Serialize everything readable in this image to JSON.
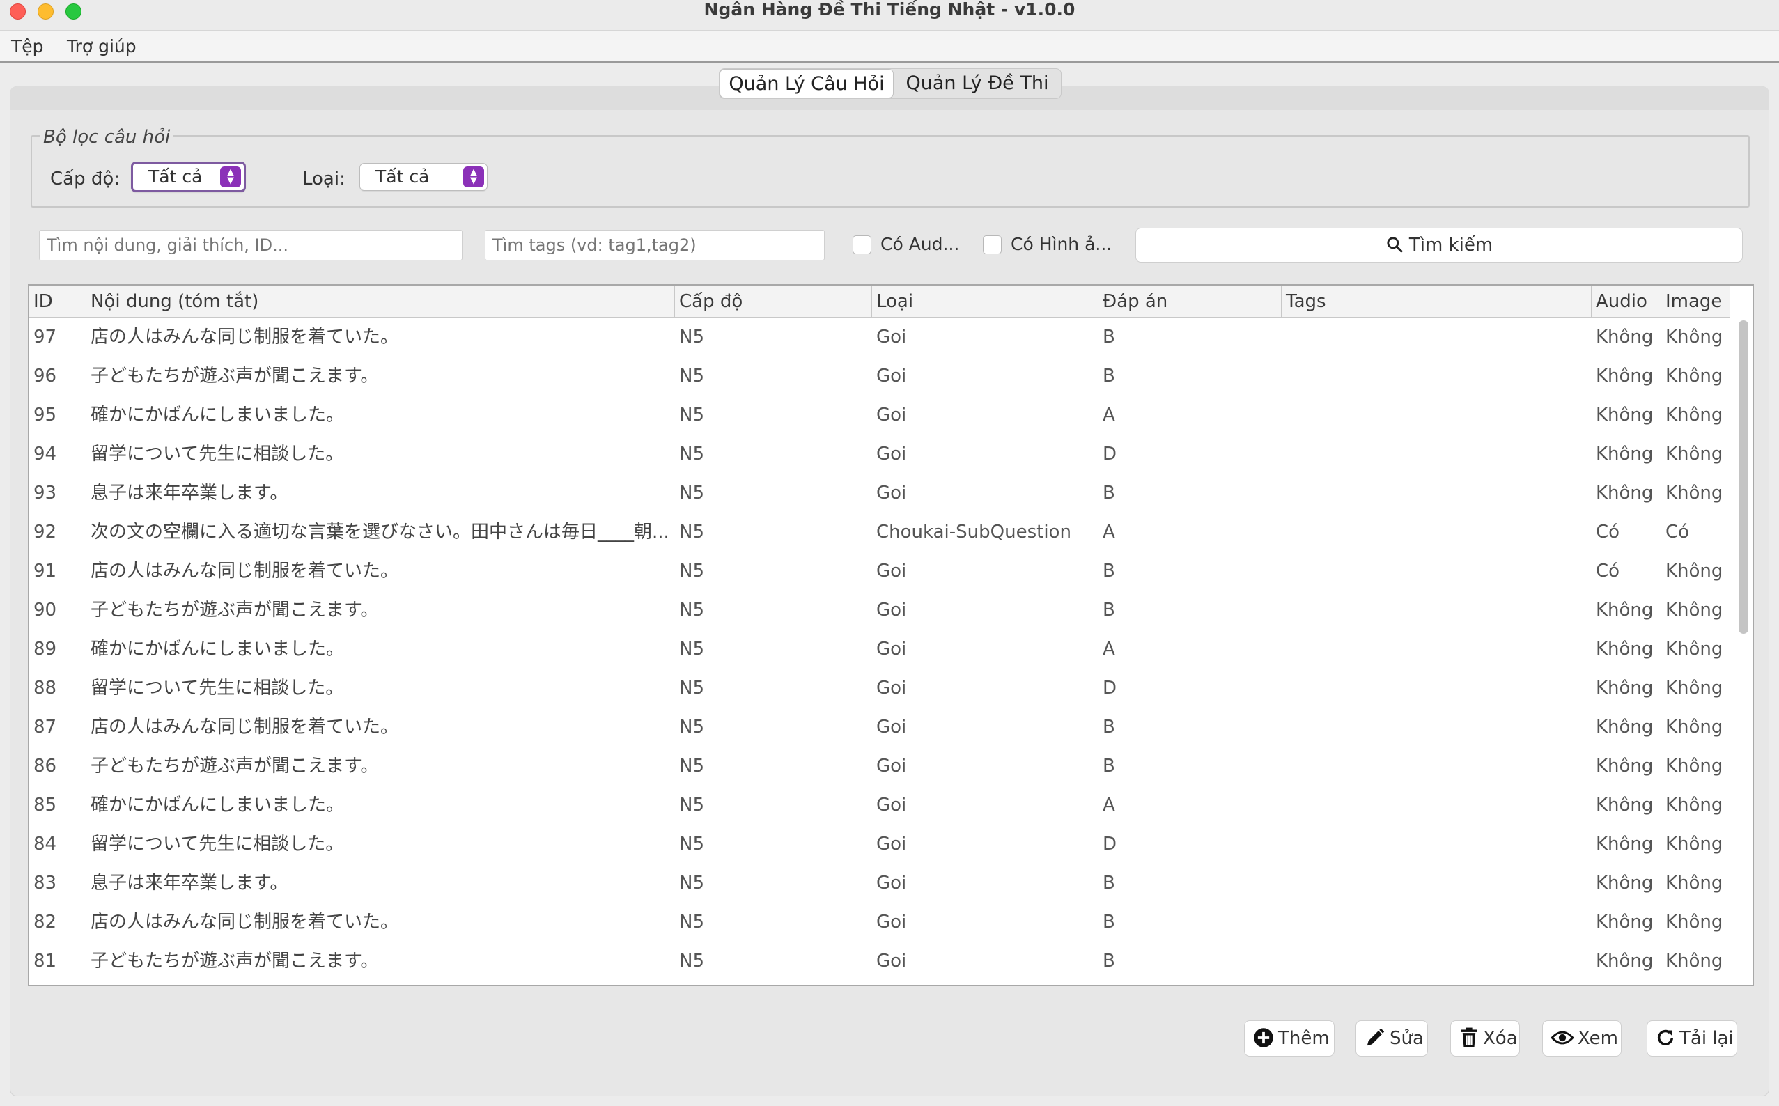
{
  "window": {
    "title": "Ngân Hàng Đề Thi Tiếng Nhật - v1.0.0"
  },
  "menu": {
    "items": [
      "Tệp",
      "Trợ giúp"
    ]
  },
  "tabs": [
    {
      "label": "Quản Lý Câu Hỏi",
      "active": true
    },
    {
      "label": "Quản Lý Đề Thi",
      "active": false
    }
  ],
  "filter": {
    "legend": "Bộ lọc câu hỏi",
    "level_label": "Cấp độ:",
    "level_value": "Tất cả",
    "type_label": "Loại:",
    "type_value": "Tất cả"
  },
  "search": {
    "content_placeholder": "Tìm nội dung, giải thích, ID...",
    "tags_placeholder": "Tìm tags (vd: tag1,tag2)",
    "audio_label": "Có Aud...",
    "image_label": "Có Hình ả...",
    "button_label": "Tìm kiếm"
  },
  "table": {
    "columns": [
      "ID",
      "Nội dung (tóm tắt)",
      "Cấp độ",
      "Loại",
      "Đáp án",
      "Tags",
      "Audio",
      "Image"
    ],
    "rows": [
      {
        "id": "97",
        "content": "店の人はみんな同じ制服を着ていた。",
        "level": "N5",
        "type": "Goi",
        "answer": "B",
        "tags": "",
        "audio": "Không",
        "image": "Không"
      },
      {
        "id": "96",
        "content": "子どもたちが遊ぶ声が聞こえます。",
        "level": "N5",
        "type": "Goi",
        "answer": "B",
        "tags": "",
        "audio": "Không",
        "image": "Không"
      },
      {
        "id": "95",
        "content": "確かにかばんにしまいました。",
        "level": "N5",
        "type": "Goi",
        "answer": "A",
        "tags": "",
        "audio": "Không",
        "image": "Không"
      },
      {
        "id": "94",
        "content": "留学について先生に相談した。",
        "level": "N5",
        "type": "Goi",
        "answer": "D",
        "tags": "",
        "audio": "Không",
        "image": "Không"
      },
      {
        "id": "93",
        "content": "息子は来年卒業します。",
        "level": "N5",
        "type": "Goi",
        "answer": "B",
        "tags": "",
        "audio": "Không",
        "image": "Không"
      },
      {
        "id": "92",
        "content": "次の文の空欄に入る適切な言葉を選びなさい。田中さんは毎日____朝...",
        "level": "N5",
        "type": "Choukai-SubQuestion",
        "answer": "A",
        "tags": "",
        "audio": "Có",
        "image": "Có"
      },
      {
        "id": "91",
        "content": "店の人はみんな同じ制服を着ていた。",
        "level": "N5",
        "type": "Goi",
        "answer": "B",
        "tags": "",
        "audio": "Có",
        "image": "Không"
      },
      {
        "id": "90",
        "content": "子どもたちが遊ぶ声が聞こえます。",
        "level": "N5",
        "type": "Goi",
        "answer": "B",
        "tags": "",
        "audio": "Không",
        "image": "Không"
      },
      {
        "id": "89",
        "content": "確かにかばんにしまいました。",
        "level": "N5",
        "type": "Goi",
        "answer": "A",
        "tags": "",
        "audio": "Không",
        "image": "Không"
      },
      {
        "id": "88",
        "content": "留学について先生に相談した。",
        "level": "N5",
        "type": "Goi",
        "answer": "D",
        "tags": "",
        "audio": "Không",
        "image": "Không"
      },
      {
        "id": "87",
        "content": "店の人はみんな同じ制服を着ていた。",
        "level": "N5",
        "type": "Goi",
        "answer": "B",
        "tags": "",
        "audio": "Không",
        "image": "Không"
      },
      {
        "id": "86",
        "content": "子どもたちが遊ぶ声が聞こえます。",
        "level": "N5",
        "type": "Goi",
        "answer": "B",
        "tags": "",
        "audio": "Không",
        "image": "Không"
      },
      {
        "id": "85",
        "content": "確かにかばんにしまいました。",
        "level": "N5",
        "type": "Goi",
        "answer": "A",
        "tags": "",
        "audio": "Không",
        "image": "Không"
      },
      {
        "id": "84",
        "content": "留学について先生に相談した。",
        "level": "N5",
        "type": "Goi",
        "answer": "D",
        "tags": "",
        "audio": "Không",
        "image": "Không"
      },
      {
        "id": "83",
        "content": "息子は来年卒業します。",
        "level": "N5",
        "type": "Goi",
        "answer": "B",
        "tags": "",
        "audio": "Không",
        "image": "Không"
      },
      {
        "id": "82",
        "content": "店の人はみんな同じ制服を着ていた。",
        "level": "N5",
        "type": "Goi",
        "answer": "B",
        "tags": "",
        "audio": "Không",
        "image": "Không"
      },
      {
        "id": "81",
        "content": "子どもたちが遊ぶ声が聞こえます。",
        "level": "N5",
        "type": "Goi",
        "answer": "B",
        "tags": "",
        "audio": "Không",
        "image": "Không"
      }
    ]
  },
  "actions": {
    "add": "Thêm",
    "edit": "Sửa",
    "delete": "Xóa",
    "view": "Xem",
    "reload": "Tải lại"
  },
  "icons": {
    "search": "search-icon",
    "add": "plus-circle-icon",
    "edit": "pencil-icon",
    "delete": "trash-icon",
    "view": "eye-icon",
    "reload": "refresh-icon",
    "combo_arrow": "up-down-chevron-icon"
  },
  "colors": {
    "accent": "#8b31b8",
    "focus_ring": "#7d5aa0"
  }
}
